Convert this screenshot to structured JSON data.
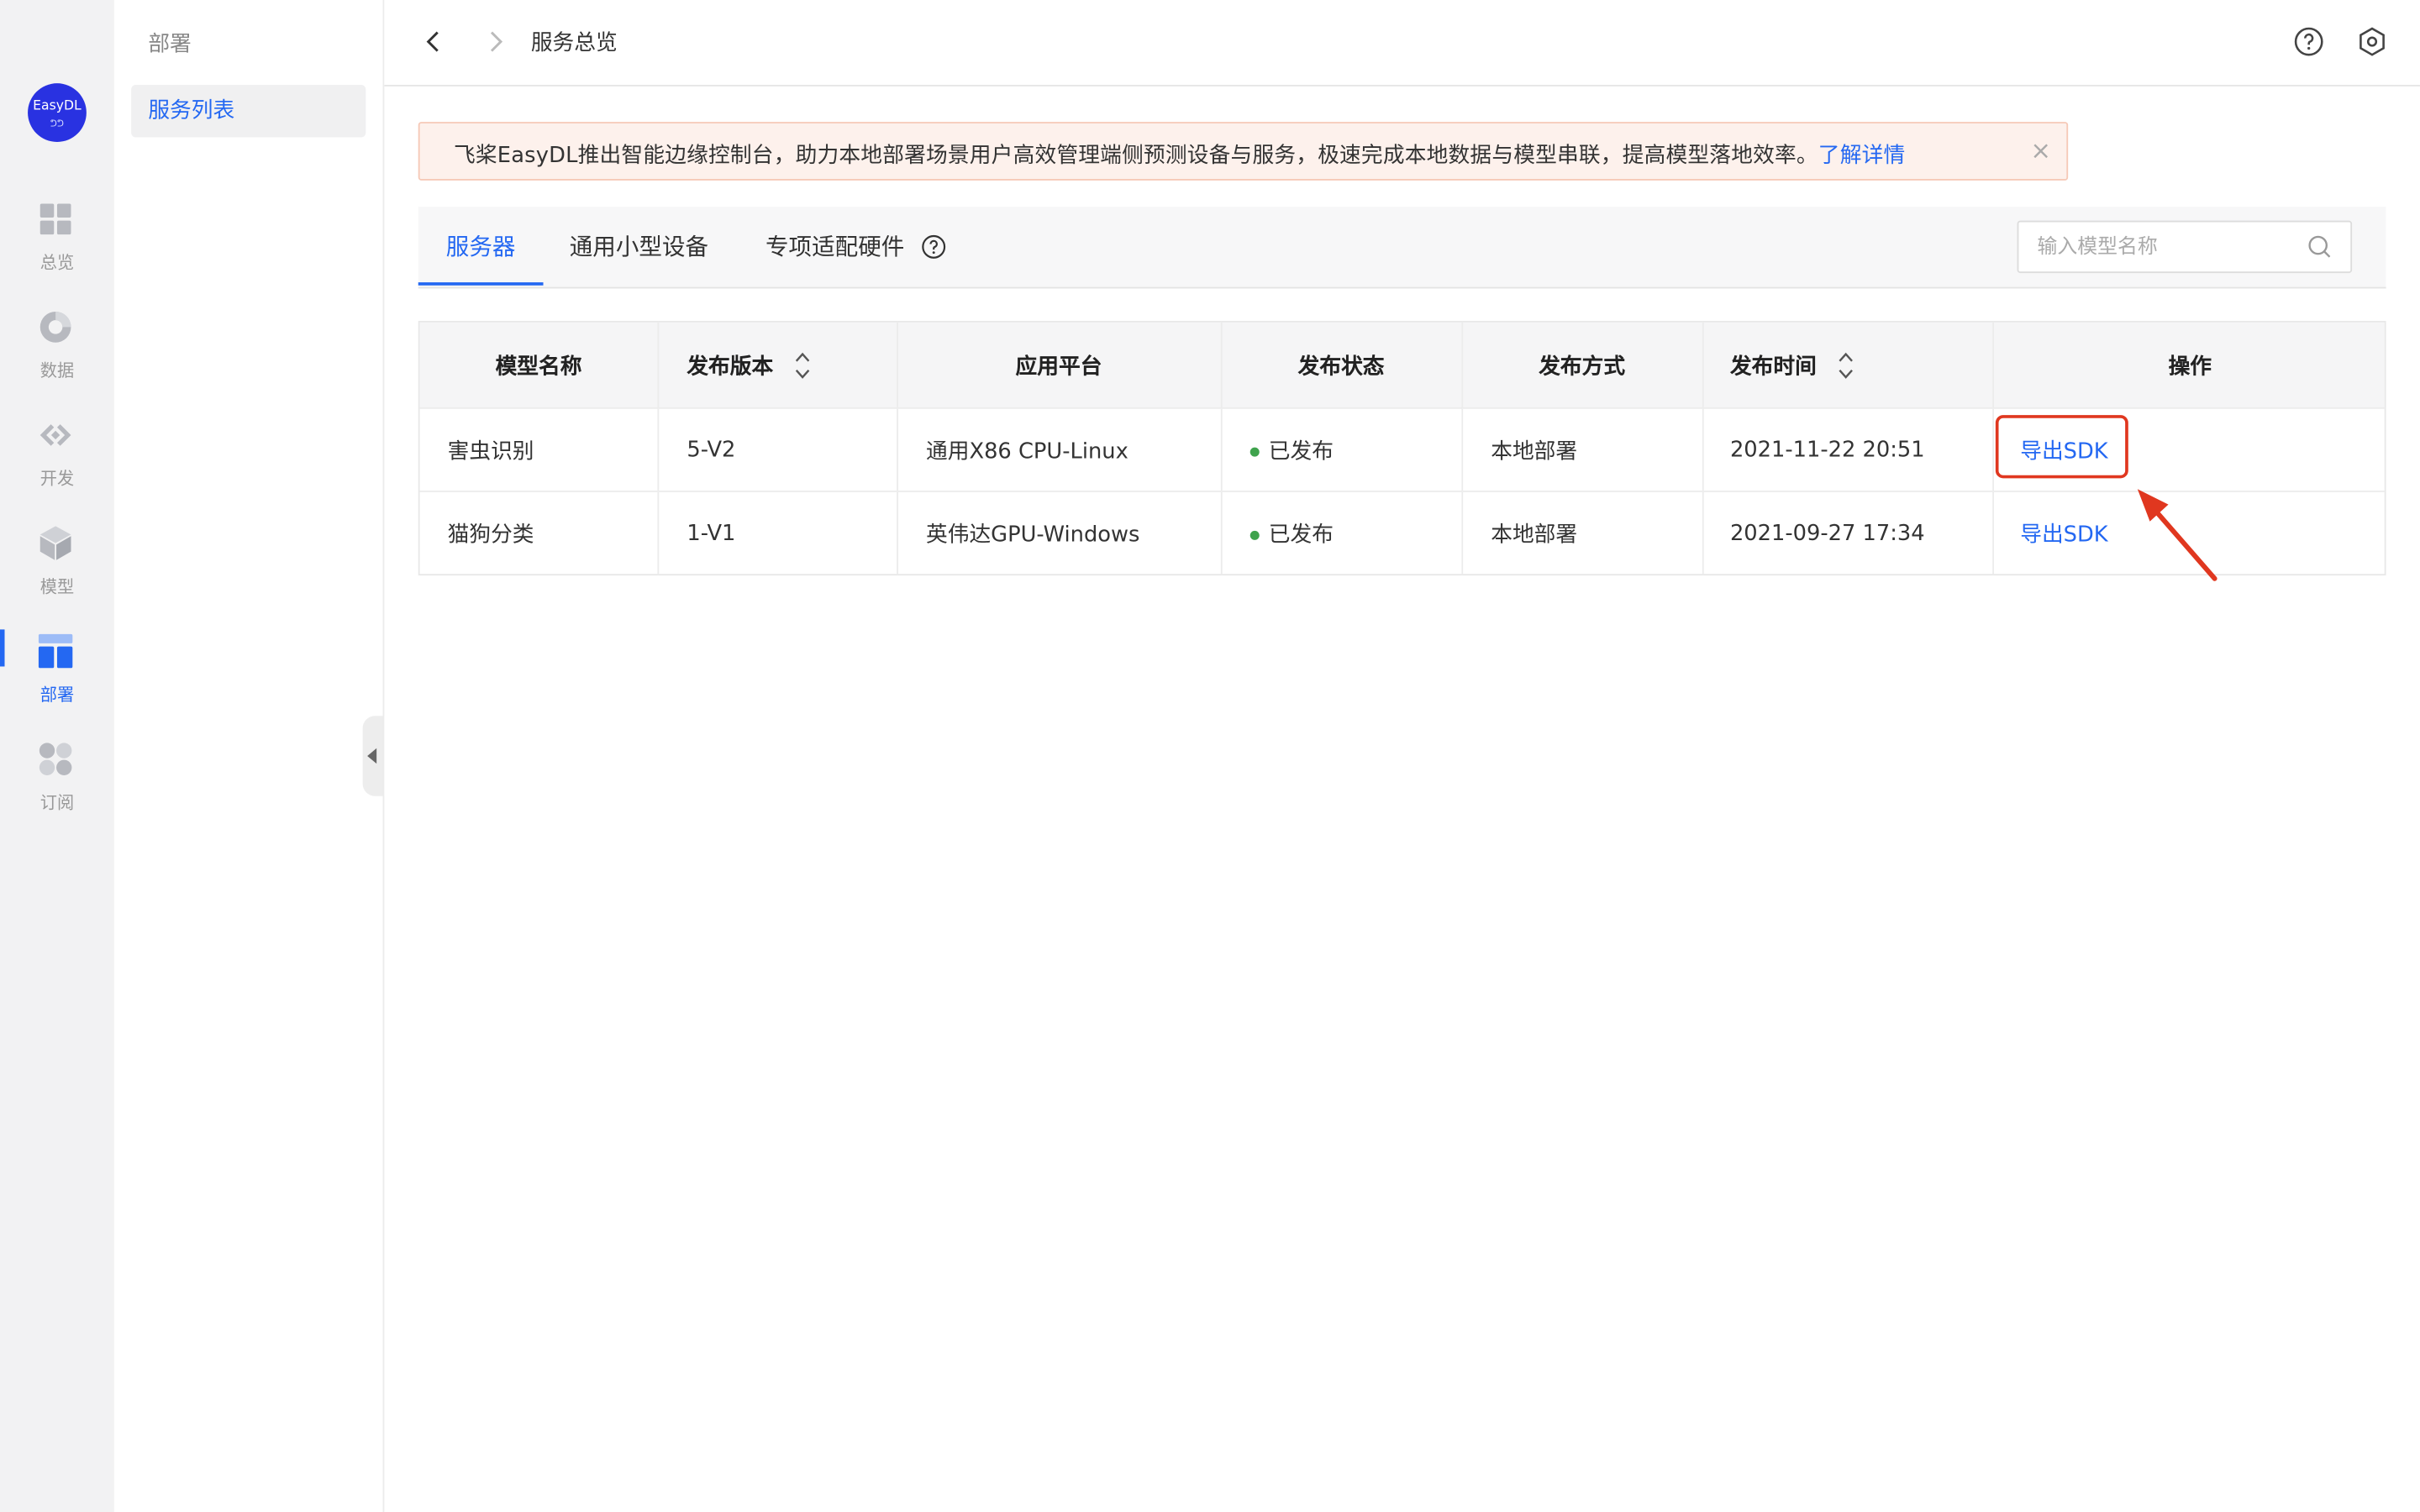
{
  "rail": {
    "logo_text": "EasyDL",
    "logo_sub": "ᕤᕤ",
    "items": [
      {
        "label": "总览",
        "icon": "overview-grid-icon"
      },
      {
        "label": "数据",
        "icon": "data-pie-icon"
      },
      {
        "label": "开发",
        "icon": "develop-code-icon"
      },
      {
        "label": "模型",
        "icon": "model-cube-icon"
      },
      {
        "label": "部署",
        "icon": "deploy-layout-icon"
      },
      {
        "label": "订阅",
        "icon": "subscribe-dots-icon"
      }
    ],
    "active": "部署"
  },
  "subside": {
    "title": "部署",
    "menu": [
      {
        "label": "服务列表"
      }
    ]
  },
  "topbar": {
    "breadcrumb": "服务总览"
  },
  "notice": {
    "text": "飞桨EasyDL推出智能边缘控制台，助力本地部署场景用户高效管理端侧预测设备与服务，极速完成本地数据与模型串联，提高模型落地效率。",
    "link": "了解详情",
    "close": "×"
  },
  "tabs": [
    {
      "label": "服务器"
    },
    {
      "label": "通用小型设备"
    },
    {
      "label": "专项适配硬件"
    }
  ],
  "active_tab": "服务器",
  "search": {
    "placeholder": "输入模型名称",
    "value": ""
  },
  "table": {
    "columns": [
      "模型名称",
      "发布版本",
      "应用平台",
      "发布状态",
      "发布方式",
      "发布时间",
      "操作"
    ],
    "rows": [
      {
        "name": "害虫识别",
        "version": "5-V2",
        "platform": "通用X86 CPU-Linux",
        "status": "已发布",
        "method": "本地部署",
        "time": "2021-11-22 20:51",
        "action": "导出SDK"
      },
      {
        "name": "猫狗分类",
        "version": "1-V1",
        "platform": "英伟达GPU-Windows",
        "status": "已发布",
        "method": "本地部署",
        "time": "2021-09-27 17:34",
        "action": "导出SDK"
      }
    ]
  },
  "colors": {
    "accent": "#2468f2",
    "highlight": "#e0371f",
    "status_ok": "#3fa34d"
  }
}
